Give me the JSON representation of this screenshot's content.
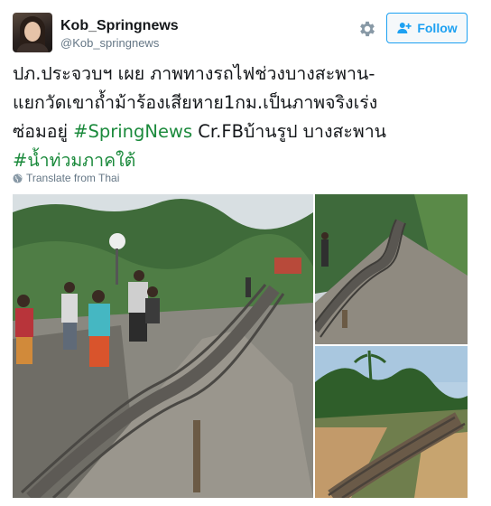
{
  "tweet": {
    "author": {
      "display_name": "Kob_Springnews",
      "handle": "@Kob_springnews"
    },
    "follow_label": "Follow",
    "text_lines": [
      "ปภ.ประจวบฯ เผย ภาพทางรถไฟช่วงบางสะพาน-",
      "แยกวัดเขาถ้ำม้าร้องเสียหาย1กม.เป็นภาพจริงเร่ง",
      "ซ่อมอยู่ ",
      "#SpringNews",
      " Cr.FBบ้านรูป บางสะพาน",
      "#น้ำท่วมภาคใต้"
    ],
    "translate_label": "Translate from Thai"
  },
  "icons": {
    "settings": "gear-icon",
    "follow": "add-user-icon",
    "translate": "globe-icon"
  },
  "colors": {
    "accent": "#1da1f2",
    "hashtag": "#1b8a3c",
    "secondary_text": "#657786"
  }
}
